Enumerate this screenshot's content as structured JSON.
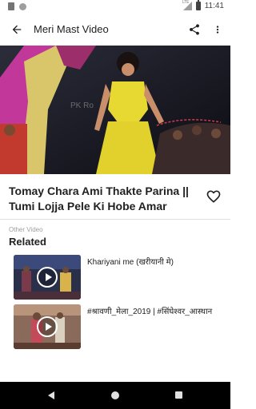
{
  "status_bar": {
    "time": "11:41",
    "network": "LTE",
    "icons": [
      "file-icon",
      "sync-dot-icon",
      "signal-icon",
      "battery-icon"
    ]
  },
  "app_bar": {
    "title": "Meri Mast Video",
    "icons": [
      "arrow-back-icon",
      "share-icon",
      "more-vert-icon"
    ]
  },
  "video": {
    "watermark": "PK Ro"
  },
  "details": {
    "title": "Tomay Chara Ami Thakte Parina || Tumi Lojja Pele Ki Hobe Amar",
    "favorite_icon": "heart-outline-icon"
  },
  "related": {
    "caption": "Other Video",
    "heading": "Related",
    "items": [
      {
        "title": "Khariyani me (खरीयानी मे)",
        "icon": "play-circle-icon"
      },
      {
        "title": "#श्रावणी_मेला_2019 | #सिंघेश्वर_आस्थान",
        "icon": "play-circle-icon"
      }
    ]
  },
  "nav_bar": {
    "icons": [
      "nav-back-icon",
      "nav-home-icon",
      "nav-recents-icon"
    ]
  },
  "colors": {
    "background": "#ffffff",
    "text": "#212121",
    "secondary_text": "#9e9e9e",
    "divider": "#e0e0e0",
    "nav_bar": "#000000"
  }
}
